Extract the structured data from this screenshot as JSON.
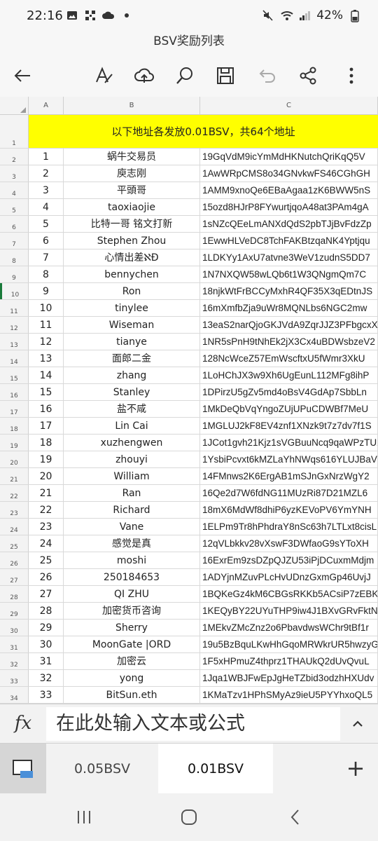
{
  "status": {
    "time": "22:16",
    "battery": "42%"
  },
  "title": "BSV奖励列表",
  "columns": [
    "A",
    "B",
    "C"
  ],
  "title_row": {
    "number": "1",
    "text": "以下地址各发放0.01BSV，共64个地址"
  },
  "rows": [
    {
      "rn": "2",
      "a": "1",
      "b": "蜗牛交易员",
      "c": "19GqVdM9icYmMdHKNutchQriKqQ5V"
    },
    {
      "rn": "3",
      "a": "2",
      "b": "庾志刚",
      "c": "1AwWRpCMS8o34GNvkwFS46CGhGH"
    },
    {
      "rn": "4",
      "a": "3",
      "b": "平頭哥",
      "c": "1AMM9xnoQe6EBaAgaa1zK6BWW5nS"
    },
    {
      "rn": "5",
      "a": "4",
      "b": "taoxiaojie",
      "c": "15ozd8HJrP8FYwurtjqoA48at3PAm4gA"
    },
    {
      "rn": "6",
      "a": "5",
      "b": "比特一哥 铭文打新",
      "c": "1sNZcQEeLmANXdQdS2pbTJjBvFdzZp"
    },
    {
      "rn": "7",
      "a": "6",
      "b": "Stephen Zhou",
      "c": "1EwwHLVeDC8TchFAKBtzqaNK4Yptjqu"
    },
    {
      "rn": "8",
      "a": "7",
      "b": "心情出差ℵÐ",
      "c": "1LDKYy1AxU7atvne3WeV1zudnS5DD7"
    },
    {
      "rn": "9",
      "a": "8",
      "b": "bennychen",
      "c": "1N7NXQW58wLQb6t1W3QNgmQm7C"
    },
    {
      "rn": "10",
      "a": "9",
      "b": "Ron",
      "c": "18njkWtFrBCCyMxhR4QF35X3qEDtnJS"
    },
    {
      "rn": "11",
      "a": "10",
      "b": "tinylee",
      "c": "16mXmfbZja9uWr8MQNLbs6NGC2mw"
    },
    {
      "rn": "12",
      "a": "11",
      "b": "Wiseman",
      "c": "13eaS2narQjoGKJVdA9ZqrJJZ3PFbgcxX"
    },
    {
      "rn": "13",
      "a": "12",
      "b": "tianye",
      "c": "1NR5sPnH9tNhEk2jX3Cx4uBDWsbzeV2"
    },
    {
      "rn": "14",
      "a": "13",
      "b": "面郎二金",
      "c": "128NcWceZ57EmWscftxU5fWmr3XkU"
    },
    {
      "rn": "15",
      "a": "14",
      "b": "zhang",
      "c": "1LoHChJX3w9Xh6UgEunL112MFg8ihP"
    },
    {
      "rn": "16",
      "a": "15",
      "b": "Stanley",
      "c": "1DPirzU5gZv5md4oBsV4GdAp7SbbLn"
    },
    {
      "rn": "17",
      "a": "16",
      "b": "盐不咸",
      "c": "1MkDeQbVqYngoZUjUPuCDWBf7MeU"
    },
    {
      "rn": "18",
      "a": "17",
      "b": "Lin Cai",
      "c": "1MGLUJ2kF8EV4znf1XNzk9t7z7dv7f1S"
    },
    {
      "rn": "19",
      "a": "18",
      "b": "xuzhengwen",
      "c": "1JCot1gvh21Kjz1sVGBuuNcq9qaWPzTU2y"
    },
    {
      "rn": "20",
      "a": "19",
      "b": "zhouyi",
      "c": "1YsbiPcvxt6kMZLaYhNWqs616YLUJBaV"
    },
    {
      "rn": "21",
      "a": "20",
      "b": "William",
      "c": "14FMnws2K6ErgAB1mSJnGxNrzWgY2"
    },
    {
      "rn": "22",
      "a": "21",
      "b": "Ran",
      "c": "16Qe2d7W6fdNG11MUzRi87D21MZL6"
    },
    {
      "rn": "23",
      "a": "22",
      "b": "Richard",
      "c": "18mX6MdWf8dhiP6yzKEVoPV6YmYNH"
    },
    {
      "rn": "24",
      "a": "23",
      "b": "Vane",
      "c": "1ELPm9Tr8hPhdraY8nSc63h7LTLxt8cisL"
    },
    {
      "rn": "25",
      "a": "24",
      "b": "感觉是真",
      "c": "12qVLbkkv28vXswF3DWfaoG9sYToXH"
    },
    {
      "rn": "26",
      "a": "25",
      "b": "moshi",
      "c": "16ExrEm9zsDZpQJZU53iPjDCuxmMdjm"
    },
    {
      "rn": "27",
      "a": "26",
      "b": "250184653",
      "c": "1ADYjnMZuvPLcHvUDnzGxmGp46UvjJ"
    },
    {
      "rn": "28",
      "a": "27",
      "b": "QI ZHU",
      "c": "1BQKeGz4kM6CBGsRKKb5ACsiP7zEBK"
    },
    {
      "rn": "29",
      "a": "28",
      "b": "加密货币咨询",
      "c": "1KEQyBY22UYuTHP9iw4J1BXvGRvFktN89"
    },
    {
      "rn": "30",
      "a": "29",
      "b": "Sherry",
      "c": "1MEkvZMcZnz2o6PbavdwsWChr9tBf1r"
    },
    {
      "rn": "31",
      "a": "30",
      "b": "MoonGate |ORD",
      "c": "19u5BzBquLKwHhGqoMRWkrUR5hwzyG7z"
    },
    {
      "rn": "32",
      "a": "31",
      "b": "加密云",
      "c": "1F5xHPmuZ4thprz1THAUkQ2dUvQvuL"
    },
    {
      "rn": "33",
      "a": "32",
      "b": "yong",
      "c": "1Jqa1WBJFwEpJgHeTZbid3odzhHXUdv"
    },
    {
      "rn": "34",
      "a": "33",
      "b": "BitSun.eth",
      "c": "1KMaTzv1HPhSMyAz9ieU5PYYhxoQL5"
    }
  ],
  "formula_bar": {
    "fx": "fx",
    "placeholder": "在此处输入文本或公式"
  },
  "sheet_tabs": [
    "0.05BSV",
    "0.01BSV"
  ],
  "add_sheet": "+"
}
